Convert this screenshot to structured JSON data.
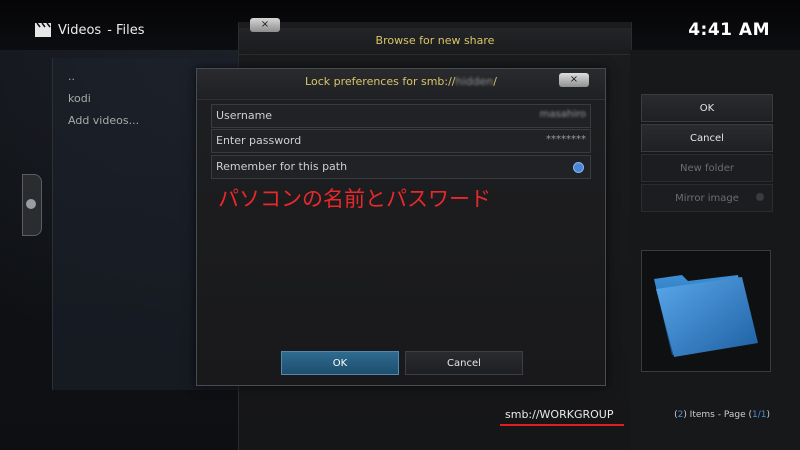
{
  "app": {
    "section": "Videos",
    "subsection": "- Files"
  },
  "clock": "4:41 AM",
  "file_list": {
    "items": [
      "..",
      "kodi",
      "Add videos..."
    ]
  },
  "browse_dialog": {
    "title": "Browse for new share",
    "close_label": "×",
    "nav_label": "<",
    "buttons": {
      "ok": "OK",
      "cancel": "Cancel",
      "new_folder": "New folder",
      "mirror_image": "Mirror image"
    },
    "current_path": "smb://WORKGROUP",
    "items_summary": {
      "count": "2",
      "prefix": "(",
      "mid": ") Items - Page (",
      "page": "1/1",
      "suffix": ")"
    }
  },
  "lock_dialog": {
    "title_prefix": "Lock preferences for smb://",
    "title_host": "hidden",
    "title_suffix": "/",
    "close_label": "×",
    "username_label": "Username",
    "username_value": "masahiro",
    "password_label": "Enter password",
    "password_value": "********",
    "remember_label": "Remember for this path",
    "remember_checked": true,
    "ok_label": "OK",
    "cancel_label": "Cancel"
  },
  "annotation_text": "パソコンの名前とパスワード",
  "colors": {
    "accent_gold": "#d8c56a",
    "accent_blue": "#4a85d6",
    "annotation_red": "#e8282a",
    "primary_button": "#2f6b90"
  }
}
